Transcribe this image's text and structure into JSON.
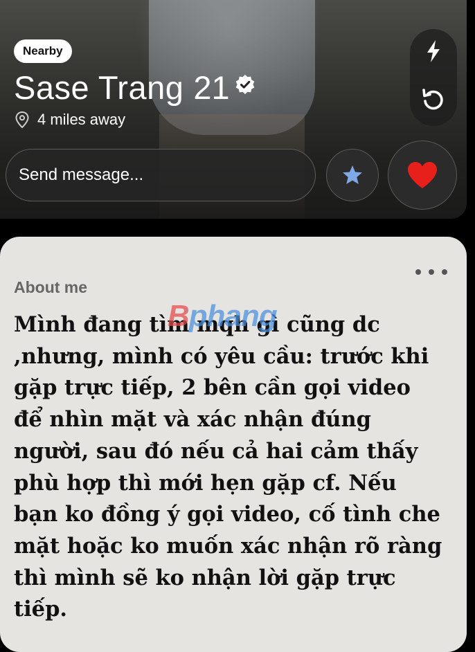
{
  "profile": {
    "badge": "Nearby",
    "name": "Sase Trang",
    "age": "21",
    "distance": "4 miles away"
  },
  "actions": {
    "message_placeholder": "Send message..."
  },
  "about": {
    "heading": "About me",
    "text": "Mình đang tìm mqh gì cũng dc ,nhưng, mình có yêu cầu: trước khi gặp trực tiếp, 2 bên cần gọi video để nhìn mặt và xác nhận đúng người, sau đó nếu cả hai cảm thấy phù hợp thì mới hẹn gặp cf. Nếu bạn ko đồng ý gọi video, cố tình che mặt hoặc ko muốn xác nhận rõ ràng thì mình sẽ ko nhận lời gặp trực tiếp."
  },
  "watermark": "Bphang",
  "colors": {
    "like": "#e8201c",
    "superlike": "#7fa8e6",
    "about_bg": "#e5e4e1"
  },
  "icons": [
    "verified-icon",
    "location-pin-icon",
    "boost-icon",
    "rewind-icon",
    "star-icon",
    "heart-icon",
    "more-icon"
  ]
}
